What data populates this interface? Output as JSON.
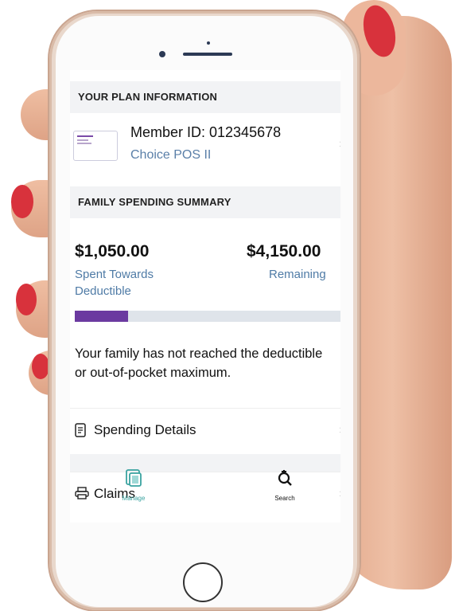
{
  "plan_info": {
    "header": "YOUR PLAN INFORMATION",
    "member_id": "Member ID: 012345678",
    "plan_name": "Choice POS II"
  },
  "spending_summary": {
    "header": "FAMILY SPENDING SUMMARY",
    "spent_amount": "$1,050.00",
    "spent_label": "Spent Towards Deductible",
    "remaining_amount": "$4,150.00",
    "remaining_label": "Remaining",
    "progress_fraction": 0.2,
    "message": "Your family has not reached the deductible or out-of-pocket maximum."
  },
  "rows": {
    "spending_details": "Spending Details",
    "claims": "Claims"
  },
  "tabbar": {
    "manage_label": "Manage",
    "search_label": "Search"
  },
  "colors": {
    "accent_purple": "#6b3aa0",
    "link_blue": "#4f7ba6",
    "tab_active": "#3aa3a0"
  }
}
